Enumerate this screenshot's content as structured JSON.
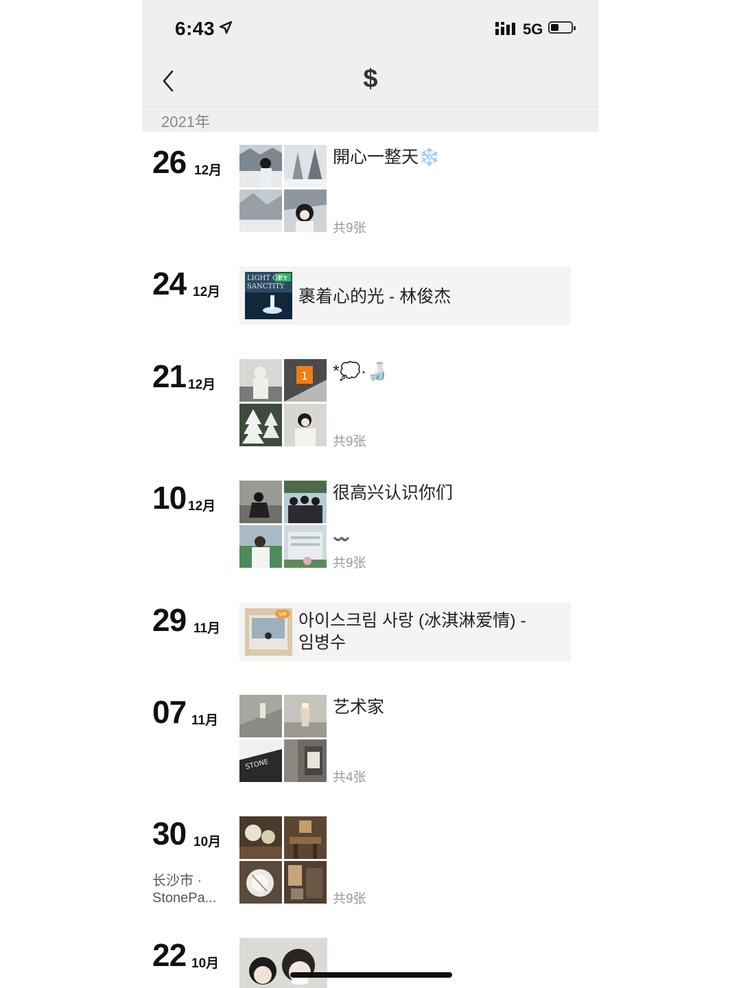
{
  "status": {
    "time": "6:43",
    "network": "5G",
    "battery_level": 0.35
  },
  "nav": {
    "title": "$"
  },
  "year": "2021年",
  "entries": [
    {
      "day": "26",
      "month": "12月",
      "text": "開心一整天❄️",
      "count": "共9张"
    },
    {
      "day": "24",
      "month": "12月",
      "music": "裹着心的光 - 林俊杰",
      "badge": "数专",
      "cover_text": "LIGHT OF SANCTITY"
    },
    {
      "day": "21",
      "month": "12月",
      "text": "*💭·🍶",
      "count": "共9张"
    },
    {
      "day": "10",
      "month": "12月",
      "text": "很高兴认识你们",
      "text2": "〰️",
      "count": "共9张"
    },
    {
      "day": "29",
      "month": "11月",
      "music_line1": "아이스크림 사랑 (冰淇淋爱情) -",
      "music_line2": "임병수",
      "badge": "VIP"
    },
    {
      "day": "07",
      "month": "11月",
      "text": "艺术家",
      "count": "共4张"
    },
    {
      "day": "30",
      "month": "10月",
      "location_line1": "长沙市 ·",
      "location_line2": "StonePa...",
      "count": "共9张"
    },
    {
      "day": "22",
      "month": "10月"
    }
  ]
}
